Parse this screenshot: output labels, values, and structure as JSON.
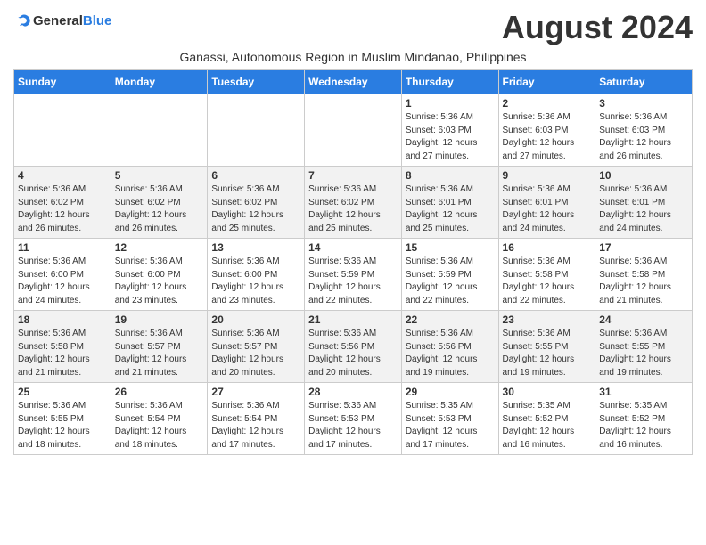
{
  "logo": {
    "text_general": "General",
    "text_blue": "Blue"
  },
  "title": "August 2024",
  "subtitle": "Ganassi, Autonomous Region in Muslim Mindanao, Philippines",
  "days_of_week": [
    "Sunday",
    "Monday",
    "Tuesday",
    "Wednesday",
    "Thursday",
    "Friday",
    "Saturday"
  ],
  "weeks": [
    [
      {
        "day": "",
        "info": ""
      },
      {
        "day": "",
        "info": ""
      },
      {
        "day": "",
        "info": ""
      },
      {
        "day": "",
        "info": ""
      },
      {
        "day": "1",
        "info": "Sunrise: 5:36 AM\nSunset: 6:03 PM\nDaylight: 12 hours\nand 27 minutes."
      },
      {
        "day": "2",
        "info": "Sunrise: 5:36 AM\nSunset: 6:03 PM\nDaylight: 12 hours\nand 27 minutes."
      },
      {
        "day": "3",
        "info": "Sunrise: 5:36 AM\nSunset: 6:03 PM\nDaylight: 12 hours\nand 26 minutes."
      }
    ],
    [
      {
        "day": "4",
        "info": "Sunrise: 5:36 AM\nSunset: 6:02 PM\nDaylight: 12 hours\nand 26 minutes."
      },
      {
        "day": "5",
        "info": "Sunrise: 5:36 AM\nSunset: 6:02 PM\nDaylight: 12 hours\nand 26 minutes."
      },
      {
        "day": "6",
        "info": "Sunrise: 5:36 AM\nSunset: 6:02 PM\nDaylight: 12 hours\nand 25 minutes."
      },
      {
        "day": "7",
        "info": "Sunrise: 5:36 AM\nSunset: 6:02 PM\nDaylight: 12 hours\nand 25 minutes."
      },
      {
        "day": "8",
        "info": "Sunrise: 5:36 AM\nSunset: 6:01 PM\nDaylight: 12 hours\nand 25 minutes."
      },
      {
        "day": "9",
        "info": "Sunrise: 5:36 AM\nSunset: 6:01 PM\nDaylight: 12 hours\nand 24 minutes."
      },
      {
        "day": "10",
        "info": "Sunrise: 5:36 AM\nSunset: 6:01 PM\nDaylight: 12 hours\nand 24 minutes."
      }
    ],
    [
      {
        "day": "11",
        "info": "Sunrise: 5:36 AM\nSunset: 6:00 PM\nDaylight: 12 hours\nand 24 minutes."
      },
      {
        "day": "12",
        "info": "Sunrise: 5:36 AM\nSunset: 6:00 PM\nDaylight: 12 hours\nand 23 minutes."
      },
      {
        "day": "13",
        "info": "Sunrise: 5:36 AM\nSunset: 6:00 PM\nDaylight: 12 hours\nand 23 minutes."
      },
      {
        "day": "14",
        "info": "Sunrise: 5:36 AM\nSunset: 5:59 PM\nDaylight: 12 hours\nand 22 minutes."
      },
      {
        "day": "15",
        "info": "Sunrise: 5:36 AM\nSunset: 5:59 PM\nDaylight: 12 hours\nand 22 minutes."
      },
      {
        "day": "16",
        "info": "Sunrise: 5:36 AM\nSunset: 5:58 PM\nDaylight: 12 hours\nand 22 minutes."
      },
      {
        "day": "17",
        "info": "Sunrise: 5:36 AM\nSunset: 5:58 PM\nDaylight: 12 hours\nand 21 minutes."
      }
    ],
    [
      {
        "day": "18",
        "info": "Sunrise: 5:36 AM\nSunset: 5:58 PM\nDaylight: 12 hours\nand 21 minutes."
      },
      {
        "day": "19",
        "info": "Sunrise: 5:36 AM\nSunset: 5:57 PM\nDaylight: 12 hours\nand 21 minutes."
      },
      {
        "day": "20",
        "info": "Sunrise: 5:36 AM\nSunset: 5:57 PM\nDaylight: 12 hours\nand 20 minutes."
      },
      {
        "day": "21",
        "info": "Sunrise: 5:36 AM\nSunset: 5:56 PM\nDaylight: 12 hours\nand 20 minutes."
      },
      {
        "day": "22",
        "info": "Sunrise: 5:36 AM\nSunset: 5:56 PM\nDaylight: 12 hours\nand 19 minutes."
      },
      {
        "day": "23",
        "info": "Sunrise: 5:36 AM\nSunset: 5:55 PM\nDaylight: 12 hours\nand 19 minutes."
      },
      {
        "day": "24",
        "info": "Sunrise: 5:36 AM\nSunset: 5:55 PM\nDaylight: 12 hours\nand 19 minutes."
      }
    ],
    [
      {
        "day": "25",
        "info": "Sunrise: 5:36 AM\nSunset: 5:55 PM\nDaylight: 12 hours\nand 18 minutes."
      },
      {
        "day": "26",
        "info": "Sunrise: 5:36 AM\nSunset: 5:54 PM\nDaylight: 12 hours\nand 18 minutes."
      },
      {
        "day": "27",
        "info": "Sunrise: 5:36 AM\nSunset: 5:54 PM\nDaylight: 12 hours\nand 17 minutes."
      },
      {
        "day": "28",
        "info": "Sunrise: 5:36 AM\nSunset: 5:53 PM\nDaylight: 12 hours\nand 17 minutes."
      },
      {
        "day": "29",
        "info": "Sunrise: 5:35 AM\nSunset: 5:53 PM\nDaylight: 12 hours\nand 17 minutes."
      },
      {
        "day": "30",
        "info": "Sunrise: 5:35 AM\nSunset: 5:52 PM\nDaylight: 12 hours\nand 16 minutes."
      },
      {
        "day": "31",
        "info": "Sunrise: 5:35 AM\nSunset: 5:52 PM\nDaylight: 12 hours\nand 16 minutes."
      }
    ]
  ]
}
